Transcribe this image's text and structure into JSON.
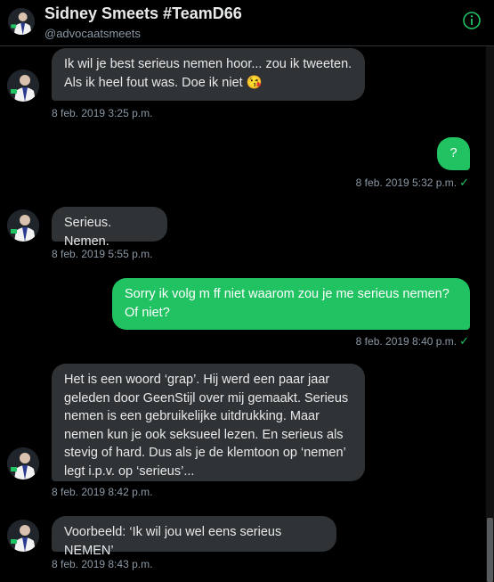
{
  "header": {
    "name": "Sidney Smeets #TeamD66",
    "handle": "@advocaatsmeets",
    "info_icon": "info-circle-icon"
  },
  "colors": {
    "background": "#000000",
    "incoming_bubble": "#2f3336",
    "outgoing_bubble": "#21c262",
    "timestamp": "#8b98a5",
    "accent": "#21c262"
  },
  "messages": [
    {
      "direction": "in",
      "lines": [
        "Ik wil je best serieus nemen hoor... zou ik tweeten.",
        "Als ik heel fout was. Doe ik niet 😘"
      ],
      "time": "8 feb. 2019 3:25 p.m."
    },
    {
      "direction": "out",
      "lines": [
        "?"
      ],
      "time": "8 feb. 2019 5:32 p.m."
    },
    {
      "direction": "in",
      "lines": [
        "Serieus. Nemen."
      ],
      "time": "8 feb. 2019 5:55 p.m."
    },
    {
      "direction": "out",
      "lines": [
        "Sorry ik volg m ff niet waarom zou je me serieus nemen?",
        "Of niet?"
      ],
      "time": "8 feb. 2019 8:40 p.m."
    },
    {
      "direction": "in",
      "lines": [
        "Het is een woord ‘grap’. Hij werd een paar jaar",
        "geleden door GeenStijl over mij gemaakt. Serieus",
        "nemen is een gebruikelijke uitdrukking. Maar",
        "nemen kun je ook seksueel lezen. En serieus als",
        "stevig of hard. Dus als je de klemtoon op ‘nemen’",
        "legt i.p.v. op ‘serieus’..."
      ],
      "time": "8 feb. 2019 8:42 p.m."
    },
    {
      "direction": "in",
      "lines": [
        "Voorbeeld: ‘Ik wil jou wel eens serieus NEMEN’"
      ],
      "time": "8 feb. 2019 8:43 p.m."
    }
  ],
  "sent_check": "✓"
}
